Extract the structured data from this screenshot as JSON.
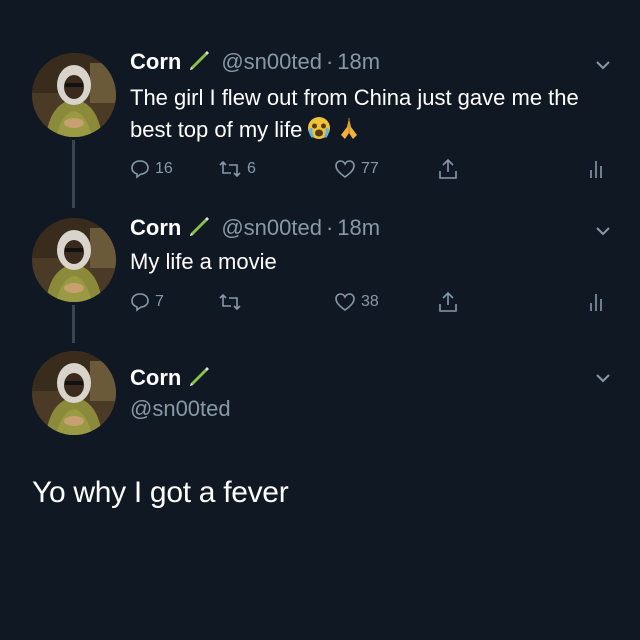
{
  "tweets": [
    {
      "name": "Corn",
      "handle": "@sn00ted",
      "dot": "·",
      "time": "18m",
      "text": "The girl I flew out from China just gave me the best top of my life",
      "replies": "16",
      "retweets": "6",
      "likes": "77"
    },
    {
      "name": "Corn",
      "handle": "@sn00ted",
      "dot": "·",
      "time": "18m",
      "text": "My life a movie",
      "replies": "7",
      "retweets": "",
      "likes": "38"
    },
    {
      "name": "Corn",
      "handle": "@sn00ted"
    }
  ],
  "main_tweet_text": "Yo why I got a fever",
  "colors": {
    "background": "#101823",
    "secondary_text": "#8899a6",
    "thread_line": "#3a4452"
  },
  "icons": [
    "pen-icon",
    "chevron-down-icon",
    "reply-icon",
    "retweet-icon",
    "like-icon",
    "share-icon",
    "analytics-icon",
    "crying-face-icon",
    "folded-hands-icon"
  ]
}
